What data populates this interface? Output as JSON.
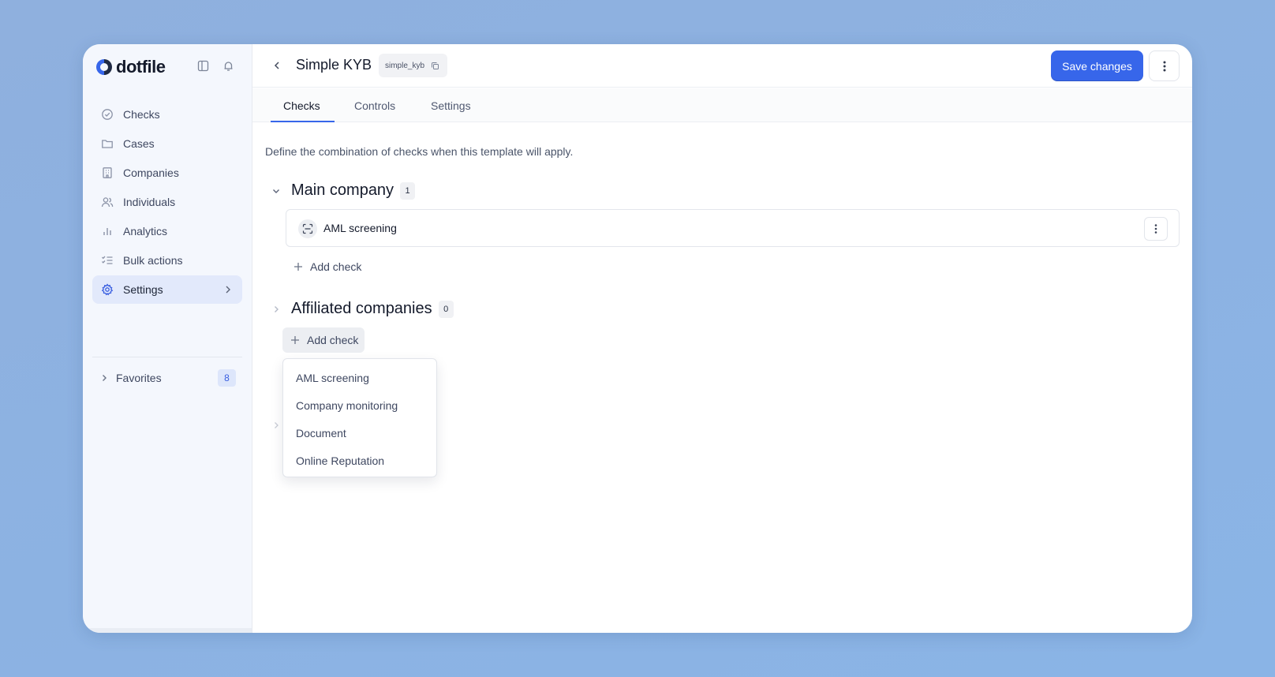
{
  "brand": {
    "name": "dotfile",
    "accent": "#3766ea"
  },
  "sidebar": {
    "items": [
      {
        "label": "Checks",
        "icon": "check-circle-icon"
      },
      {
        "label": "Cases",
        "icon": "folder-icon"
      },
      {
        "label": "Companies",
        "icon": "building-icon"
      },
      {
        "label": "Individuals",
        "icon": "users-icon"
      },
      {
        "label": "Analytics",
        "icon": "bar-chart-icon"
      },
      {
        "label": "Bulk actions",
        "icon": "list-check-icon"
      },
      {
        "label": "Settings",
        "icon": "gear-icon",
        "active": true
      }
    ],
    "favorites": {
      "label": "Favorites",
      "count": "8"
    }
  },
  "header": {
    "title": "Simple KYB",
    "slug": "simple_kyb",
    "save_label": "Save changes"
  },
  "tabs": [
    {
      "label": "Checks",
      "active": true
    },
    {
      "label": "Controls"
    },
    {
      "label": "Settings"
    }
  ],
  "main": {
    "description": "Define the combination of checks when this template will apply.",
    "sections": [
      {
        "title": "Main company",
        "count": "1",
        "checks": [
          {
            "label": "AML screening",
            "icon": "scan-icon"
          }
        ],
        "add_label": "Add check"
      },
      {
        "title": "Affiliated companies",
        "count": "0",
        "add_label": "Add check"
      }
    ],
    "dropdown": {
      "options": [
        "AML screening",
        "Company monitoring",
        "Document",
        "Online Reputation"
      ]
    }
  }
}
